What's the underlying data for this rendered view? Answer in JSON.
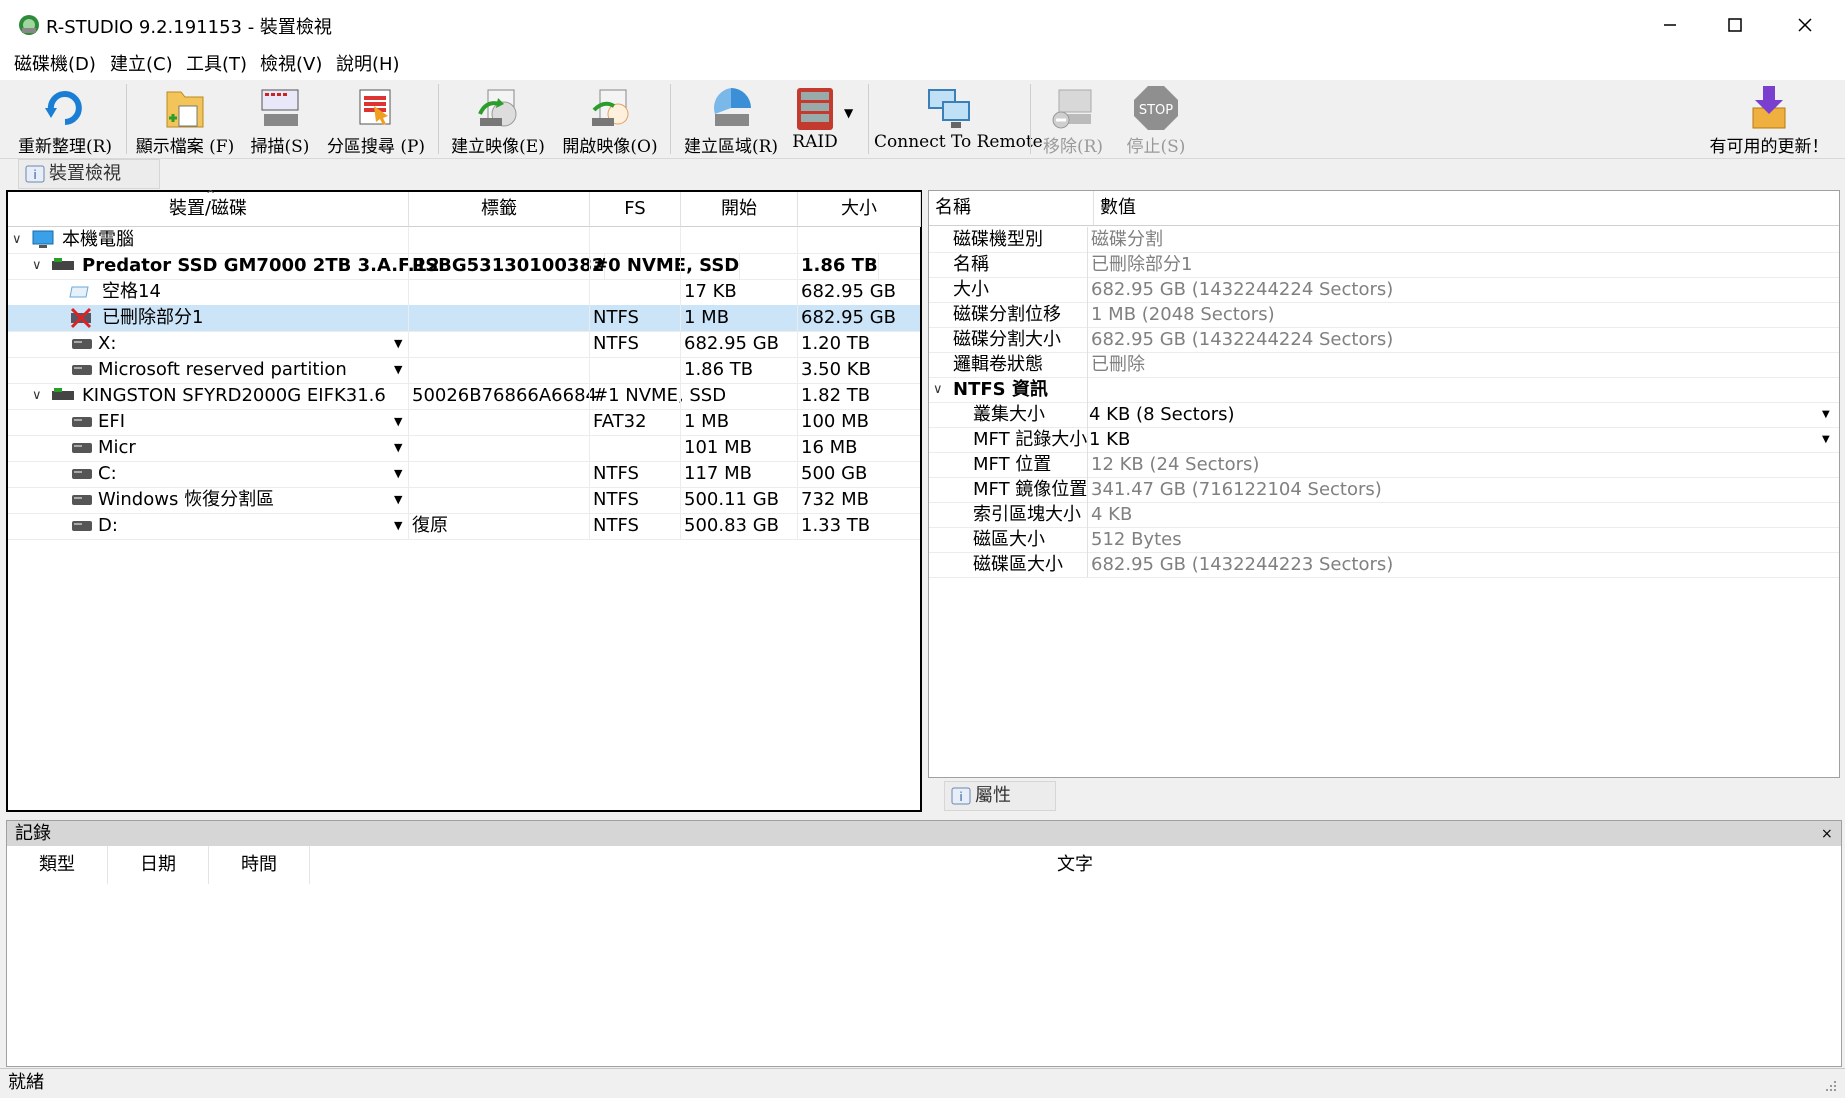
{
  "window": {
    "title": "R-STUDIO 9.2.191153 - 裝置檢視"
  },
  "menu": [
    "磁碟機(D)",
    "建立(C)",
    "工具(T)",
    "檢視(V)",
    "說明(H)"
  ],
  "toolbar": {
    "refresh": "重新整理(R)",
    "show_files": "顯示檔案 (F)",
    "scan": "掃描(S)",
    "partition_search": "分區搜尋 (P)",
    "create_image": "建立映像(E)",
    "open_image": "開啟映像(O)",
    "create_region": "建立區域(R)",
    "raid": "RAID",
    "connect_remote": "Connect To Remote",
    "remove": "移除(R)",
    "stop": "停止(S)",
    "updates": "有可用的更新！",
    "stop_icon_text": "STOP"
  },
  "tabs": {
    "device_view": "裝置檢視",
    "properties": "屬性"
  },
  "device_table": {
    "columns": [
      "裝置/磁碟",
      "標籤",
      "FS",
      "開始",
      "大小"
    ],
    "root": "本機電腦",
    "rows": [
      {
        "name": "Predator SSD GM7000 2TB 3.A.F.12",
        "label": "PSBG53130100382",
        "fs": "#0 NVME, SSD",
        "start": "",
        "size": "1.86 TB"
      },
      {
        "name": "空格14",
        "label": "",
        "fs": "",
        "start": "17 KB",
        "size": "682.95 GB"
      },
      {
        "name": "已刪除部分1",
        "label": "",
        "fs": "NTFS",
        "start": "1 MB",
        "size": "682.95 GB"
      },
      {
        "name": "X:",
        "label": "",
        "fs": "NTFS",
        "start": "682.95 GB",
        "size": "1.20 TB"
      },
      {
        "name": "Microsoft reserved partition",
        "label": "",
        "fs": "",
        "start": "1.86 TB",
        "size": "3.50 KB"
      },
      {
        "name": "KINGSTON SFYRD2000G EIFK31.6",
        "label": "50026B76866A6684",
        "fs": "#1 NVME, SSD",
        "start": "",
        "size": "1.82 TB"
      },
      {
        "name": "EFI",
        "label": "",
        "fs": "FAT32",
        "start": "1 MB",
        "size": "100 MB"
      },
      {
        "name": "Micr",
        "label": "",
        "fs": "",
        "start": "101 MB",
        "size": "16 MB"
      },
      {
        "name": "C:",
        "label": "",
        "fs": "NTFS",
        "start": "117 MB",
        "size": "500 GB"
      },
      {
        "name": "Windows 恢復分割區",
        "label": "",
        "fs": "NTFS",
        "start": "500.11 GB",
        "size": "732 MB"
      },
      {
        "name": "D:",
        "label": "復原",
        "fs": "NTFS",
        "start": "500.83 GB",
        "size": "1.33 TB"
      }
    ]
  },
  "properties": {
    "columns": [
      "名稱",
      "數值"
    ],
    "rows": [
      {
        "name": "磁碟機型別",
        "value": "磁碟分割"
      },
      {
        "name": "名稱",
        "value": "已刪除部分1"
      },
      {
        "name": "大小",
        "value": "682.95 GB (1432244224 Sectors)"
      },
      {
        "name": "磁碟分割位移",
        "value": "1 MB (2048 Sectors)"
      },
      {
        "name": "磁碟分割大小",
        "value": "682.95 GB (1432244224 Sectors)"
      },
      {
        "name": "邏輯卷狀態",
        "value": "已刪除"
      }
    ],
    "section": "NTFS 資訊",
    "ntfs_rows": [
      {
        "name": "叢集大小",
        "value": "4 KB (8 Sectors)"
      },
      {
        "name": "MFT 記錄大小",
        "value": "1 KB"
      },
      {
        "name": "MFT 位置",
        "value": "12 KB (24 Sectors)"
      },
      {
        "name": "MFT 鏡像位置",
        "value": "341.47 GB (716122104 Sectors)"
      },
      {
        "name": "索引區塊大小",
        "value": "4 KB"
      },
      {
        "name": "磁區大小",
        "value": "512 Bytes"
      },
      {
        "name": "磁碟區大小",
        "value": "682.95 GB (1432244223 Sectors)"
      }
    ]
  },
  "log": {
    "title": "記錄",
    "columns": [
      "類型",
      "日期",
      "時間",
      "文字"
    ]
  },
  "status": "就緒"
}
